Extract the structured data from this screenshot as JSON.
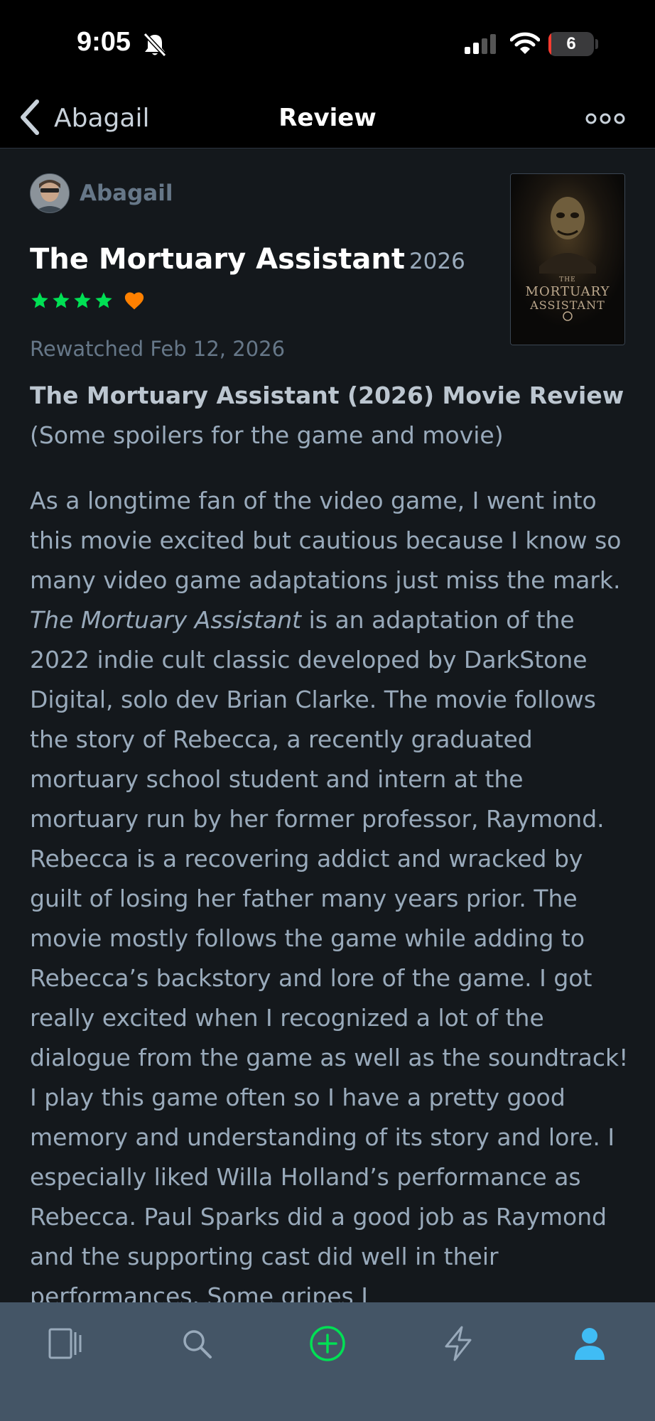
{
  "status_bar": {
    "time": "9:05",
    "battery_level": "6"
  },
  "nav": {
    "back_label": "Abagail",
    "title": "Review"
  },
  "review": {
    "author": "Abagail",
    "film_title": "The Mortuary Assistant",
    "film_year": "2026",
    "rating_stars": 4,
    "liked": true,
    "rewatched_label": "Rewatched Feb 12, 2026",
    "poster_text": [
      "THE",
      "MORTUARY",
      "ASSISTANT"
    ],
    "heading": "The Mortuary Assistant (2026) Movie Review",
    "subheading": "(Some spoilers for the game and movie)",
    "body_before_italic": "As a longtime fan of the video game, I went into this movie excited but cautious because I know so many video game adaptations just miss the mark. ",
    "body_italic": "The Mortuary Assistant",
    "body_after_italic": " is an adaptation of the 2022 indie cult classic developed by DarkStone Digital, solo dev Brian Clarke. The movie follows the story of Rebecca, a recently graduated mortuary school student and intern at the mortuary run by her former professor, Raymond. Rebecca is a recovering addict and wracked by guilt of losing her father many years prior. The movie mostly follows the game while adding to Rebecca’s backstory and lore of the game. I got really excited when I recognized a lot of the dialogue from the game as well as the soundtrack! I play this game often so I have a pretty good memory and understanding of its story and lore. I especially liked Willa Holland’s performance as Rebecca. Paul Sparks did a good job as Raymond and the supporting cast did well in their performances. Some gripes I"
  },
  "colors": {
    "background": "#14181c",
    "star_green": "#00e054",
    "heart_orange": "#ff8000",
    "tab_bar": "#445566",
    "active_tab": "#40bcf4"
  },
  "tab_bar": {
    "items": [
      {
        "icon": "films-icon",
        "active": false
      },
      {
        "icon": "search-icon",
        "active": false
      },
      {
        "icon": "add-icon",
        "active": false
      },
      {
        "icon": "activity-icon",
        "active": false
      },
      {
        "icon": "profile-icon",
        "active": true
      }
    ]
  }
}
